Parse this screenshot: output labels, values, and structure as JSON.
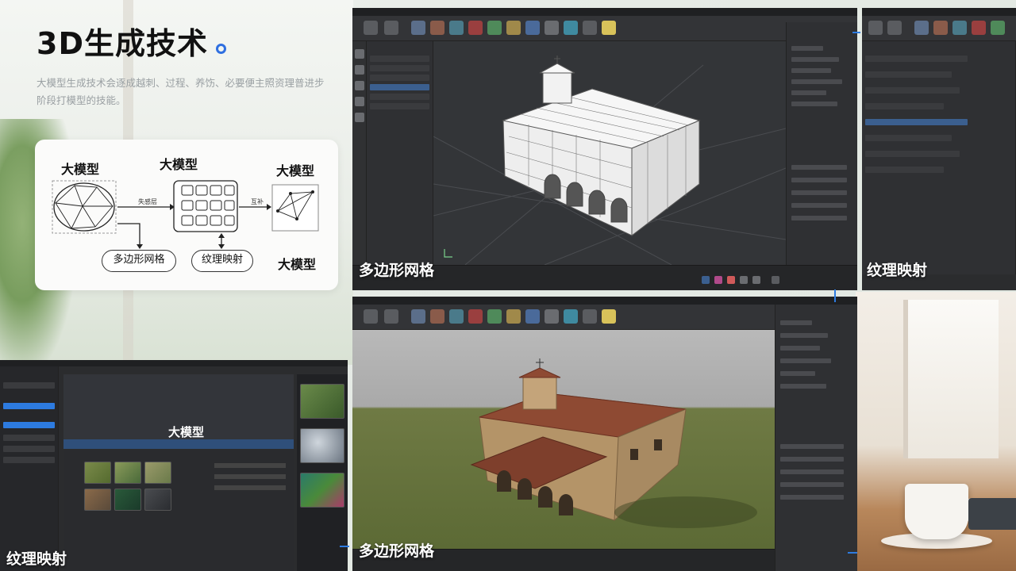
{
  "heading": {
    "title": "3D生成技术",
    "subtitle": "大模型生成技术会逐成越刺、过程、养饬、必要便主照资理普进步阶段打模型的技能。"
  },
  "diagram": {
    "label_top_left": "大模型",
    "label_top_center": "大模型",
    "label_top_right": "大模型",
    "label_bottom_right": "大模型",
    "arrow_left_text": "失感层",
    "arrow_right_text": "互补",
    "pill_left": "多边形网格",
    "pill_right": "纹理映射"
  },
  "panels": {
    "top_center_caption": "多边形网格",
    "top_right_caption": "纹理映射",
    "bottom_left_caption": "纹理映射",
    "bottom_left_title": "大模型",
    "bottom_center_caption": "多边形网格"
  },
  "colors": {
    "accent": "#2f6fe0",
    "panel_bg": "#2b2c2e",
    "ui_selection": "#3b5f8f"
  }
}
